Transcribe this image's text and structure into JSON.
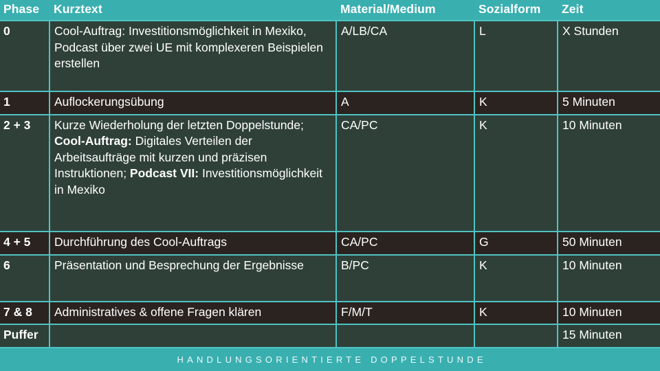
{
  "slide": {
    "footer_caption": "HANDLUNGSORIENTIERTE DOPPELSTUNDE",
    "accent_teal": "#3aafb0",
    "grid_line": "#4fc3c4",
    "row_dark": "#2b231f",
    "row_green": "#2f4039",
    "text_color": "#ffffff"
  },
  "table": {
    "headers": {
      "phase": "Phase",
      "kurztext": "Kurztext",
      "material": "Material/Medium",
      "sozialform": "Sozialform",
      "zeit": "Zeit"
    },
    "rows": [
      {
        "phase": "0",
        "kurztext": "Cool-Auftrag: Investitionsmöglichkeit in Mexiko, Podcast über zwei UE mit komplexeren Beispielen erstellen",
        "material": "A/LB/CA",
        "sozialform": "L",
        "zeit": "X Stunden",
        "shade": "green"
      },
      {
        "phase": "1",
        "kurztext": "Auflockerungsübung",
        "material": "A",
        "sozialform": "K",
        "zeit": "5 Minuten",
        "shade": "dark"
      },
      {
        "phase": "2 + 3",
        "kurztext_parts": [
          {
            "text": "Kurze Wiederholung der letzten Doppelstunde; ",
            "bold": false
          },
          {
            "text": "Cool-Auftrag:",
            "bold": true
          },
          {
            "text": " Digitales Verteilen der Arbeitsaufträge mit kurzen und präzisen Instruktionen; ",
            "bold": false
          },
          {
            "text": "Podcast VII:",
            "bold": true
          },
          {
            "text": " Investitionsmöglichkeit in Mexiko",
            "bold": false
          }
        ],
        "material": "CA/PC",
        "sozialform": "K",
        "zeit": "10 Minuten",
        "shade": "green"
      },
      {
        "phase": "4 + 5",
        "kurztext": "Durchführung des Cool-Auftrags",
        "material": "CA/PC",
        "sozialform": "G",
        "zeit": "50 Minuten",
        "shade": "dark"
      },
      {
        "phase": "6",
        "kurztext": "Präsentation und Besprechung der Ergebnisse",
        "material": "B/PC",
        "sozialform": "K",
        "zeit": "10 Minuten",
        "shade": "green"
      },
      {
        "phase": "7 & 8",
        "kurztext": "Administratives & offene Fragen klären",
        "material": "F/M/T",
        "sozialform": "K",
        "zeit": "10 Minuten",
        "shade": "dark"
      },
      {
        "phase": "Puffer",
        "kurztext": "",
        "material": "",
        "sozialform": "",
        "zeit": "15 Minuten",
        "shade": "green"
      }
    ]
  }
}
